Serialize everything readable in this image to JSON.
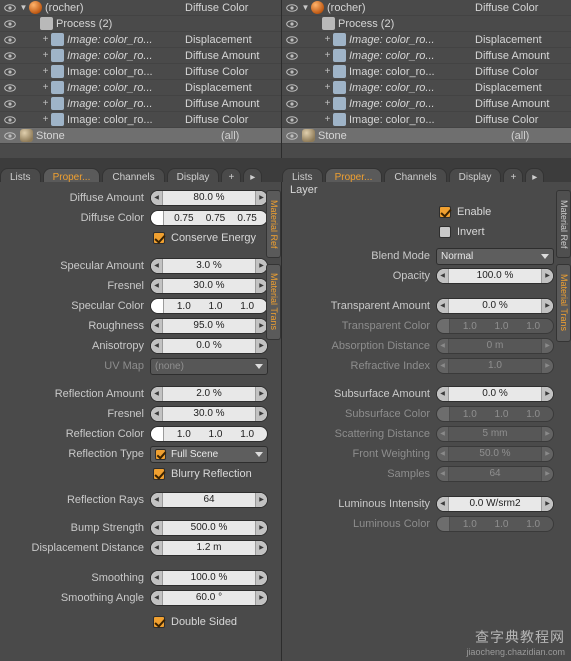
{
  "outliner": {
    "panes": [
      {
        "name": "left-outliner",
        "rows": [
          {
            "indent": 1,
            "tri": "▼",
            "icon": "sphere",
            "label": "(rocher)",
            "right": "Diffuse Color",
            "plus": ""
          },
          {
            "indent": 2,
            "tri": "",
            "icon": "gear",
            "label": "Process (2)",
            "right": "",
            "plus": ""
          },
          {
            "indent": 3,
            "tri": "",
            "icon": "img",
            "label": "Image: color_ro...",
            "right": "Displacement",
            "plus": "+",
            "italic": true
          },
          {
            "indent": 3,
            "tri": "",
            "icon": "img",
            "label": "Image: color_ro...",
            "right": "Diffuse Amount",
            "plus": "+",
            "italic": true
          },
          {
            "indent": 3,
            "tri": "",
            "icon": "img",
            "label": "Image: color_ro...",
            "right": "Diffuse Color",
            "plus": "+",
            "italic": false
          },
          {
            "indent": 3,
            "tri": "",
            "icon": "img",
            "label": "Image: color_ro...",
            "right": "Displacement",
            "plus": "+",
            "italic": true
          },
          {
            "indent": 3,
            "tri": "",
            "icon": "img",
            "label": "Image: color_ro...",
            "right": "Diffuse Amount",
            "plus": "+",
            "italic": true
          },
          {
            "indent": 3,
            "tri": "",
            "icon": "img",
            "label": "Image: color_ro...",
            "right": "Diffuse Color",
            "plus": "+",
            "italic": false
          }
        ],
        "selected_row": {
          "icon": "rock",
          "label": "Stone",
          "value": "(all)"
        }
      },
      {
        "name": "right-outliner",
        "rows": [
          {
            "indent": 1,
            "tri": "▼",
            "icon": "sphere",
            "label": "(rocher)",
            "right": "Diffuse Color",
            "plus": ""
          },
          {
            "indent": 2,
            "tri": "",
            "icon": "gear",
            "label": "Process (2)",
            "right": "",
            "plus": ""
          },
          {
            "indent": 3,
            "tri": "",
            "icon": "img",
            "label": "Image: color_ro...",
            "right": "Displacement",
            "plus": "+",
            "italic": true
          },
          {
            "indent": 3,
            "tri": "",
            "icon": "img",
            "label": "Image: color_ro...",
            "right": "Diffuse Amount",
            "plus": "+",
            "italic": true
          },
          {
            "indent": 3,
            "tri": "",
            "icon": "img",
            "label": "Image: color_ro...",
            "right": "Diffuse Color",
            "plus": "+",
            "italic": false
          },
          {
            "indent": 3,
            "tri": "",
            "icon": "img",
            "label": "Image: color_ro...",
            "right": "Displacement",
            "plus": "+",
            "italic": true
          },
          {
            "indent": 3,
            "tri": "",
            "icon": "img",
            "label": "Image: color_ro...",
            "right": "Diffuse Amount",
            "plus": "+",
            "italic": true
          },
          {
            "indent": 3,
            "tri": "",
            "icon": "img",
            "label": "Image: color_ro...",
            "right": "Diffuse Color",
            "plus": "+",
            "italic": false
          }
        ],
        "selected_row": {
          "icon": "rock",
          "label": "Stone",
          "value": "(all)"
        }
      }
    ]
  },
  "tabs_left": [
    {
      "label": "Lists",
      "active": false
    },
    {
      "label": "Proper...",
      "active": true
    },
    {
      "label": "Channels",
      "active": false
    },
    {
      "label": "Display",
      "active": false
    },
    {
      "label": "+",
      "active": false
    },
    {
      "label": "▸",
      "active": false
    }
  ],
  "tabs_right": [
    {
      "label": "Lists",
      "active": false
    },
    {
      "label": "Proper...",
      "active": true
    },
    {
      "label": "Channels",
      "active": false
    },
    {
      "label": "Display",
      "active": false
    },
    {
      "label": "+",
      "active": false
    },
    {
      "label": "▸",
      "active": false
    }
  ],
  "left_panel": {
    "vtabs": [
      {
        "label": "Material Ref",
        "accent": true
      },
      {
        "label": "Material Trans",
        "accent": true
      }
    ],
    "fields": [
      {
        "id": "diffuse_amount",
        "label": "Diffuse Amount",
        "type": "number",
        "value": "80.0 %",
        "disabled": false
      },
      {
        "id": "diffuse_color",
        "label": "Diffuse Color",
        "type": "color",
        "value": [
          "0.75",
          "0.75",
          "0.75"
        ],
        "disabled": false
      },
      {
        "id": "conserve_energy",
        "label": "",
        "type": "checkbox",
        "checked": true,
        "text": "Conserve Energy"
      },
      {
        "id": "specular_amount",
        "label": "Specular Amount",
        "type": "number",
        "value": "3.0 %",
        "disabled": false
      },
      {
        "id": "specular_fresnel",
        "label": "Fresnel",
        "type": "number",
        "value": "30.0 %",
        "disabled": false
      },
      {
        "id": "specular_color",
        "label": "Specular Color",
        "type": "color",
        "value": [
          "1.0",
          "1.0",
          "1.0"
        ],
        "disabled": false
      },
      {
        "id": "roughness",
        "label": "Roughness",
        "type": "number",
        "value": "95.0 %",
        "disabled": false
      },
      {
        "id": "anisotropy",
        "label": "Anisotropy",
        "type": "number",
        "value": "0.0 %",
        "disabled": false
      },
      {
        "id": "uv_map",
        "label": "UV Map",
        "type": "dropdown",
        "value": "(none)",
        "disabled": true
      },
      {
        "id": "reflection_amount",
        "label": "Reflection Amount",
        "type": "number",
        "value": "2.0 %",
        "disabled": false
      },
      {
        "id": "reflection_fresnel",
        "label": "Fresnel",
        "type": "number",
        "value": "30.0 %",
        "disabled": false
      },
      {
        "id": "reflection_color",
        "label": "Reflection Color",
        "type": "color",
        "value": [
          "1.0",
          "1.0",
          "1.0"
        ],
        "disabled": false
      },
      {
        "id": "reflection_type",
        "label": "Reflection Type",
        "type": "dropdown_check",
        "value": "Full Scene",
        "disabled": false
      },
      {
        "id": "blurry_reflection",
        "label": "",
        "type": "checkbox",
        "checked": true,
        "text": "Blurry Reflection"
      },
      {
        "id": "reflection_rays",
        "label": "Reflection Rays",
        "type": "number",
        "value": "64",
        "disabled": false
      },
      {
        "id": "bump_strength",
        "label": "Bump Strength",
        "type": "number",
        "value": "500.0 %",
        "disabled": false
      },
      {
        "id": "displacement_distance",
        "label": "Displacement Distance",
        "type": "number",
        "value": "1.2 m",
        "disabled": false
      },
      {
        "id": "smoothing",
        "label": "Smoothing",
        "type": "number",
        "value": "100.0 %",
        "disabled": false
      },
      {
        "id": "smoothing_angle",
        "label": "Smoothing Angle",
        "type": "number",
        "value": "60.0 °",
        "disabled": false
      },
      {
        "id": "double_sided",
        "label": "",
        "type": "checkbox",
        "checked": true,
        "text": "Double Sided"
      }
    ]
  },
  "right_panel": {
    "header": "Layer",
    "vtabs": [
      {
        "label": "Material Ref",
        "accent": false
      },
      {
        "label": "Material Trans",
        "accent": true
      }
    ],
    "fields": [
      {
        "id": "enable",
        "label": "",
        "type": "checkbox",
        "checked": true,
        "text": "Enable"
      },
      {
        "id": "invert",
        "label": "",
        "type": "checkbox",
        "checked": false,
        "text": "Invert"
      },
      {
        "id": "blend_mode",
        "label": "Blend Mode",
        "type": "dropdown",
        "value": "Normal",
        "disabled": false
      },
      {
        "id": "opacity",
        "label": "Opacity",
        "type": "number",
        "value": "100.0 %",
        "disabled": false
      },
      {
        "id": "transparent_amount",
        "label": "Transparent Amount",
        "type": "number",
        "value": "0.0 %",
        "disabled": false
      },
      {
        "id": "transparent_color",
        "label": "Transparent Color",
        "type": "color",
        "value": [
          "1.0",
          "1.0",
          "1.0"
        ],
        "disabled": true
      },
      {
        "id": "absorption_distance",
        "label": "Absorption Distance",
        "type": "number",
        "value": "0 m",
        "disabled": true
      },
      {
        "id": "refractive_index",
        "label": "Refractive Index",
        "type": "number",
        "value": "1.0",
        "disabled": true
      },
      {
        "id": "subsurface_amount",
        "label": "Subsurface Amount",
        "type": "number",
        "value": "0.0 %",
        "disabled": false
      },
      {
        "id": "subsurface_color",
        "label": "Subsurface Color",
        "type": "color",
        "value": [
          "1.0",
          "1.0",
          "1.0"
        ],
        "disabled": true
      },
      {
        "id": "scattering_distance",
        "label": "Scattering Distance",
        "type": "number",
        "value": "5 mm",
        "disabled": true
      },
      {
        "id": "front_weighting",
        "label": "Front Weighting",
        "type": "number",
        "value": "50.0 %",
        "disabled": true
      },
      {
        "id": "samples",
        "label": "Samples",
        "type": "number",
        "value": "64",
        "disabled": true
      },
      {
        "id": "luminous_intensity",
        "label": "Luminous Intensity",
        "type": "number",
        "value": "0.0 W/srm2",
        "disabled": false
      },
      {
        "id": "luminous_color",
        "label": "Luminous Color",
        "type": "color",
        "value": [
          "1.0",
          "1.0",
          "1.0"
        ],
        "disabled": true
      }
    ]
  },
  "watermark": {
    "big": "查字典教程网",
    "small": "jiaocheng.chazidian.com"
  }
}
